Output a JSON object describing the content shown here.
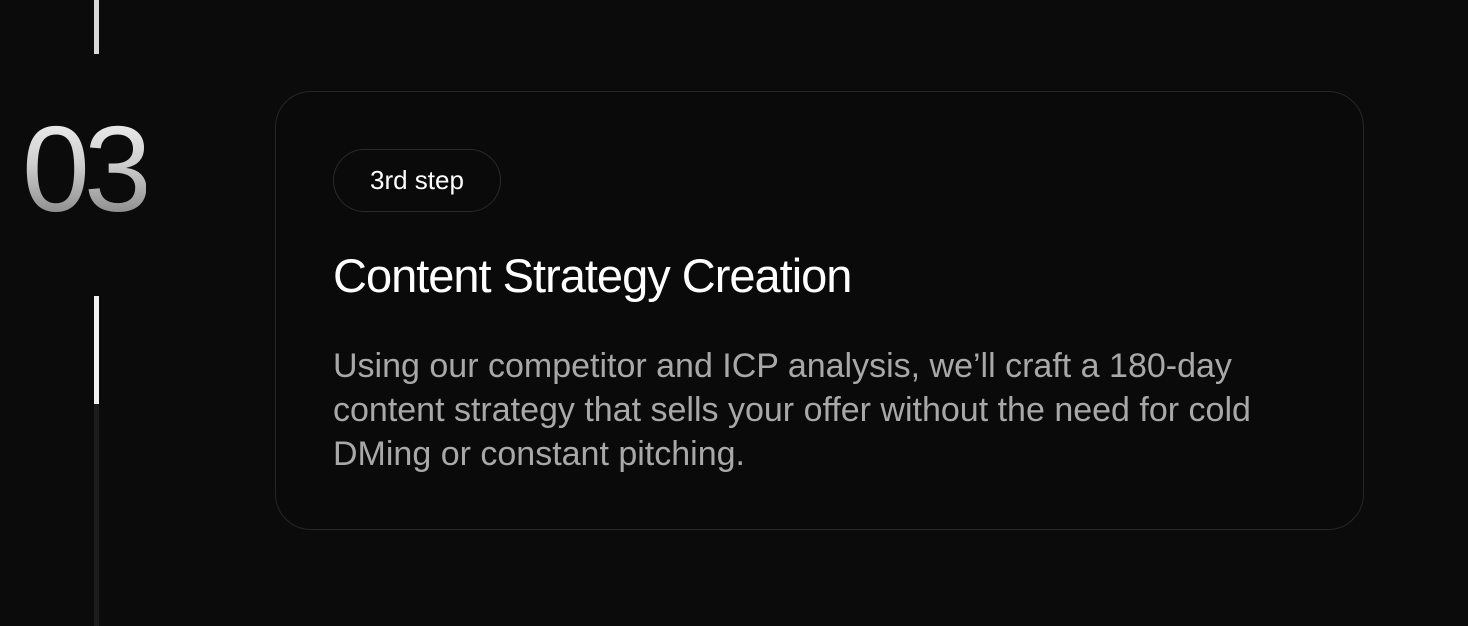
{
  "timeline": {
    "step_number": "03"
  },
  "card": {
    "badge_label": "3rd step",
    "title": "Content Strategy Creation",
    "description": "Using our competitor and ICP analysis, we’ll craft a 180-day content strategy that sells your offer without the need for cold DMing or constant pitching."
  },
  "colors": {
    "background": "#0b0b0b",
    "card_border": "#262626",
    "title": "#ffffff",
    "description": "#a8a8a8",
    "timeline_active": "#f2f2f2",
    "timeline_track": "#1c1c1c"
  }
}
